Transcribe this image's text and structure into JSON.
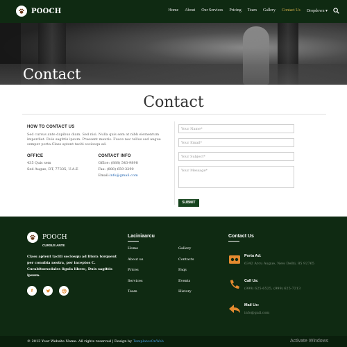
{
  "brand": {
    "name": "POOCH",
    "tagline": "CURSUS ANTE"
  },
  "nav": {
    "items": [
      {
        "label": "Home"
      },
      {
        "label": "About"
      },
      {
        "label": "Our Services"
      },
      {
        "label": "Pricing"
      },
      {
        "label": "Team"
      },
      {
        "label": "Gallery"
      },
      {
        "label": "Contact Us"
      },
      {
        "label": "Dropdown ▾"
      }
    ],
    "active": "Contact Us",
    "search_icon": "search-icon"
  },
  "hero": {
    "title": "Contact"
  },
  "main": {
    "title": "Contact"
  },
  "contact": {
    "how_heading": "HOW TO CONTACT US",
    "intro": "Sed cursus ante dapibus diam. Sed nisi. Nulla quis sem at nibh elementum imperdiet. Duis sagittis ipsum. Praesent mauris. Fusce nec tellus sed augue semper porta.Class aptent taciti sociosqu ad.",
    "office": {
      "heading": "OFFICE",
      "line1": "435 Quis sem",
      "line2": "Sed Augue, DT, 77335, U.A.E"
    },
    "info": {
      "heading": "CONTACT INFO",
      "office": "Office: (888) 543-9898",
      "fax": "Fax: (888) 659-3290",
      "email_label": "Email:",
      "email": "info@gmail.com"
    }
  },
  "form": {
    "name_placeholder": "Your Name*",
    "email_placeholder": "Your Email*",
    "subject_placeholder": "Your Subject*",
    "message_placeholder": "Your Message*",
    "submit_label": "SUBMIT"
  },
  "footer": {
    "about": "Class aptent taciti sociosqu ad litora torquent per conubia nostra, per inceptos C. Curabitursodales ligula libero, Duis sagittis ipsum.",
    "social_icons": [
      "facebook-icon",
      "twitter-icon",
      "dribbble-icon"
    ],
    "links_heading": "Laciniaarcu",
    "links_col1": [
      "Home",
      "About us",
      "Prices",
      "Services",
      "Team"
    ],
    "links_col2": [
      "Gallery",
      "Contacts",
      "Faqs",
      "Events",
      "History"
    ],
    "contact_heading": "Contact Us",
    "post_title": "Porta Ad:",
    "post_value": "6342 Arcu Augue, New Delhi, 85 92765",
    "call_title": "Call Us:",
    "call_value": "(999) 625-6525, (999) 625-7213",
    "mail_title": "Mail Us:",
    "mail_value": "info@gail.com",
    "copyright_prefix": "© 2013 Your Website Name. All rights reserved | Design by",
    "copyright_link": "TemplatesOnWeb"
  },
  "watermark": "Activate Windows",
  "colors": {
    "nav_bg": "#0f2a12",
    "active_nav": "#d7b34b",
    "footer_bg": "#0f2a12",
    "button_bg": "#15431d",
    "icon_accent": "#e48a2f",
    "link": "#2a6bb5"
  }
}
